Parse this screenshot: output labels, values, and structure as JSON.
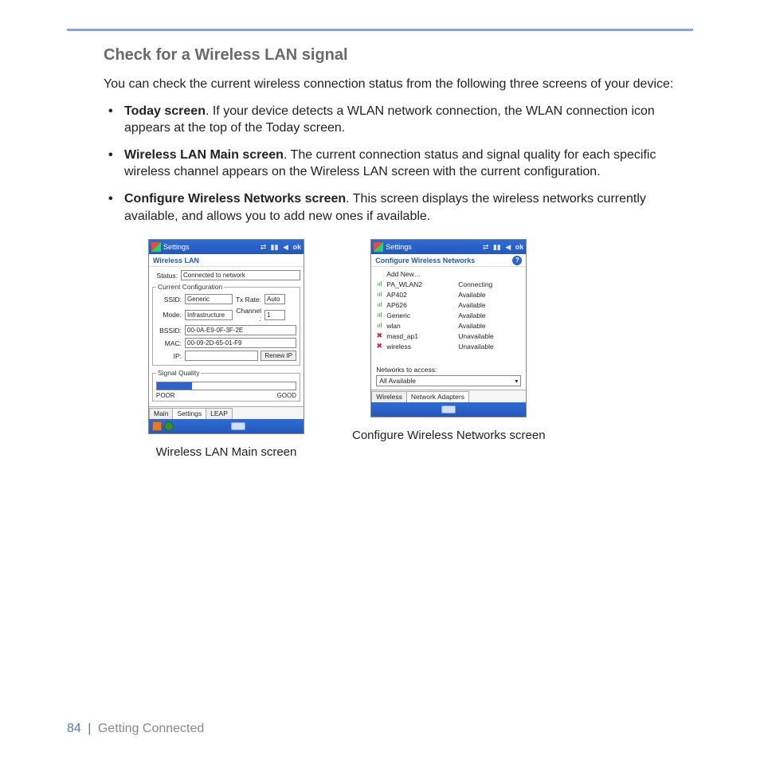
{
  "section_title": "Check for a Wireless LAN signal",
  "intro": "You can check the current wireless connection status from the following three screens of your device:",
  "bullets": [
    {
      "lead": "Today screen",
      "rest": ". If your device detects a WLAN network connection, the WLAN connection icon appears at the top of the Today screen."
    },
    {
      "lead": "Wireless LAN Main screen",
      "rest": ". The current connection status and signal quality for each specific wireless channel appears on the Wireless LAN screen with the current configuration."
    },
    {
      "lead": "Configure Wireless Networks screen",
      "rest": ". This screen displays the wireless networks currently available, and allows you to add new ones if available."
    }
  ],
  "fig1": {
    "titlebar": "Settings",
    "ok": "ok",
    "subtitle": "Wireless LAN",
    "status_label": "Status:",
    "status_value": "Connected to network",
    "group_config": "Current Configuration",
    "ssid_label": "SSID:",
    "ssid_value": "Generic",
    "txrate_label": "Tx Rate:",
    "txrate_value": "Auto",
    "mode_label": "Mode:",
    "mode_value": "Infrastructure",
    "channel_label": "Channel :",
    "channel_value": "1",
    "bssid_label": "BSSID:",
    "bssid_value": "00-0A-E9-0F-3F-2E",
    "mac_label": "MAC:",
    "mac_value": "00-09-2D-65-01-F9",
    "ip_label": "IP:",
    "ip_value": "",
    "renew_btn": "Renew IP",
    "group_signal": "Signal Quality",
    "poor": "POOR",
    "good": "GOOD",
    "tabs": [
      "Main",
      "Settings",
      "LEAP"
    ],
    "caption": "Wireless LAN Main screen"
  },
  "fig2": {
    "titlebar": "Settings",
    "ok": "ok",
    "subtitle": "Configure Wireless Networks",
    "add_new": "Add New…",
    "networks": [
      {
        "name": "PA_WLAN2",
        "status": "Connecting",
        "ok": true
      },
      {
        "name": "AP402",
        "status": "Available",
        "ok": true
      },
      {
        "name": "AP626",
        "status": "Available",
        "ok": true
      },
      {
        "name": "Generic",
        "status": "Available",
        "ok": true
      },
      {
        "name": "wlan",
        "status": "Available",
        "ok": true
      },
      {
        "name": "masd_ap1",
        "status": "Unavailable",
        "ok": false
      },
      {
        "name": "wireless",
        "status": "Unavailable",
        "ok": false
      }
    ],
    "access_label": "Networks to access:",
    "access_value": "All Available",
    "tabs": [
      "Wireless",
      "Network Adapters"
    ],
    "caption": "Configure Wireless Networks screen"
  },
  "footer": {
    "page": "84",
    "chapter": "Getting Connected"
  }
}
